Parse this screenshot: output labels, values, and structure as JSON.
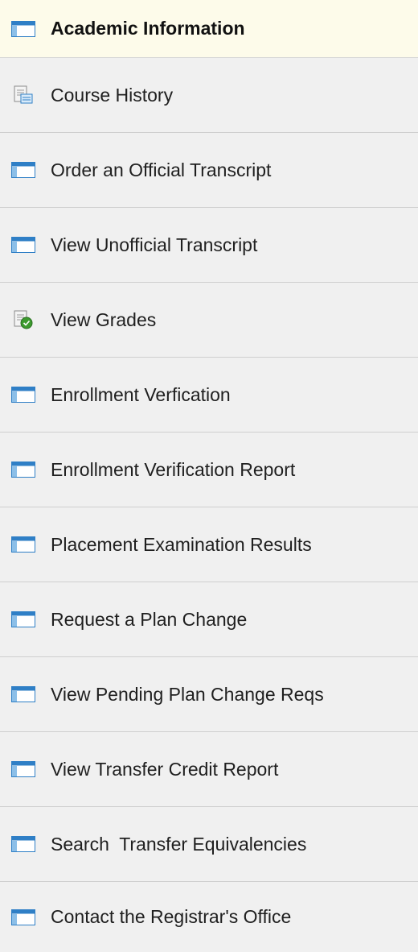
{
  "menu": {
    "header": {
      "label": "Academic Information",
      "icon": "window-icon"
    },
    "items": [
      {
        "label": "Course History",
        "icon": "document-icon"
      },
      {
        "label": "Order an Official Transcript",
        "icon": "window-icon"
      },
      {
        "label": "View Unofficial Transcript",
        "icon": "window-icon"
      },
      {
        "label": "View Grades",
        "icon": "grades-document-icon"
      },
      {
        "label": "Enrollment Verfication",
        "icon": "window-icon"
      },
      {
        "label": "Enrollment Verification Report",
        "icon": "window-icon"
      },
      {
        "label": "Placement Examination Results",
        "icon": "window-icon"
      },
      {
        "label": "Request a Plan Change",
        "icon": "window-icon"
      },
      {
        "label": "View Pending Plan Change Reqs",
        "icon": "window-icon"
      },
      {
        "label": "View Transfer Credit Report",
        "icon": "window-icon"
      },
      {
        "label": "Search  Transfer Equivalencies",
        "icon": "window-icon"
      },
      {
        "label": "Contact the Registrar's Office",
        "icon": "window-icon"
      }
    ]
  },
  "colors": {
    "header_bg": "#fdfbea",
    "item_bg": "#f0f0f0",
    "divider": "#cfcfcf",
    "icon_blue": "#2e7fc7"
  }
}
